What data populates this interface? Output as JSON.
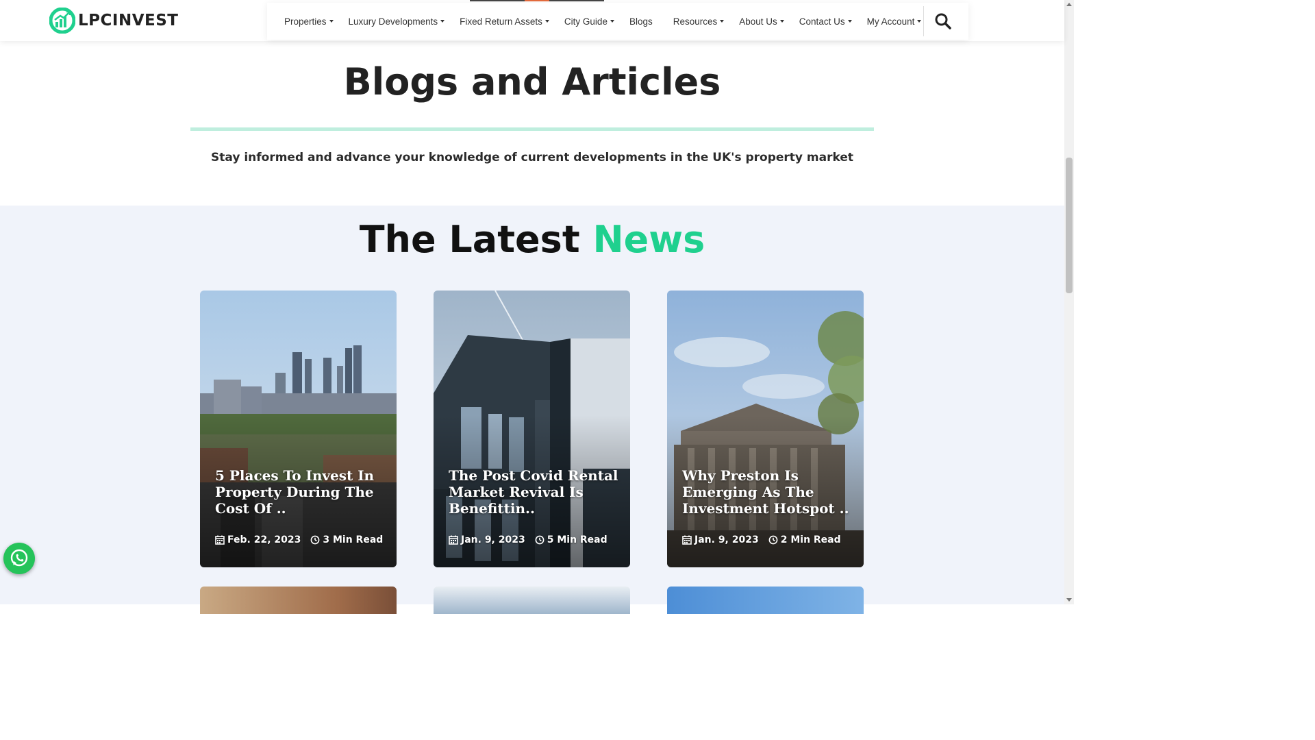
{
  "brand": {
    "name_part1": "LPC",
    "name_part2": "INVEST",
    "accent": "#1fd08e"
  },
  "nav": {
    "items": [
      {
        "label": "Properties",
        "dropdown": true
      },
      {
        "label": "Luxury Developments",
        "dropdown": true
      },
      {
        "label": "Fixed Return Assets",
        "dropdown": true
      },
      {
        "label": "City Guide",
        "dropdown": true
      },
      {
        "label": "Blogs",
        "dropdown": false
      },
      {
        "label": "Resources",
        "dropdown": true
      },
      {
        "label": "About Us",
        "dropdown": true
      },
      {
        "label": "Contact Us",
        "dropdown": true
      },
      {
        "label": "My Account",
        "dropdown": true
      }
    ],
    "search_icon": "search-icon"
  },
  "hero": {
    "title": "Blogs and Articles",
    "subtitle": "Stay informed and advance your knowledge of current developments in the UK's property market"
  },
  "news": {
    "title_part1": "The Latest",
    "title_part2": "News",
    "cards": [
      {
        "title": "5 Places To Invest In Property During The Cost Of ..",
        "date": "Feb. 22, 2023",
        "read_time": "3 Min Read"
      },
      {
        "title": "The Post Covid Rental Market Revival Is Benefittin..",
        "date": "Jan. 9, 2023",
        "read_time": "5 Min Read"
      },
      {
        "title": "Why Preston Is Emerging As The Investment Hotspot ..",
        "date": "Jan. 9, 2023",
        "read_time": "2 Min Read"
      }
    ]
  },
  "floating": {
    "whatsapp_icon": "whatsapp-icon"
  }
}
